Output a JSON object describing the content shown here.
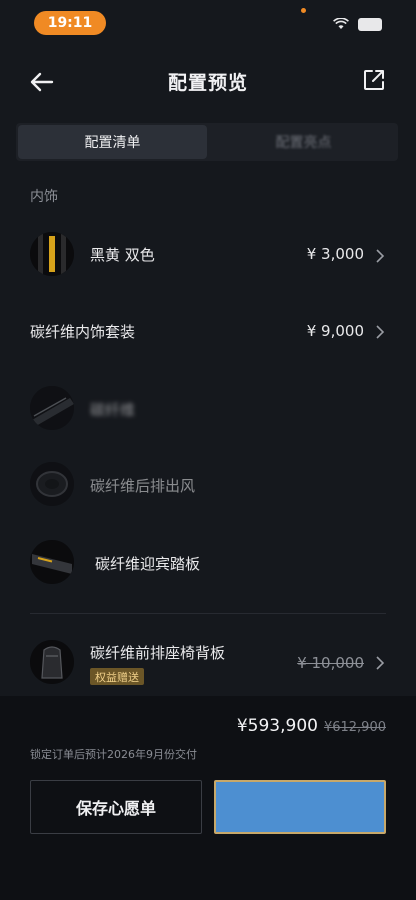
{
  "status": {
    "time": "19:11"
  },
  "header": {
    "title": "配置预览"
  },
  "tabs": [
    {
      "label": "配置清单"
    },
    {
      "label": "配置亮点"
    }
  ],
  "section": {
    "label": "内饰"
  },
  "items": [
    {
      "name": "黑黄 双色",
      "price": "¥ 3,000"
    },
    {
      "name": "碳纤维内饰套装",
      "price": "¥ 9,000"
    },
    {
      "name": "碳纤维"
    },
    {
      "name": "碳纤维后排出风"
    },
    {
      "name": "碳纤维迎宾踏板"
    },
    {
      "name": "碳纤维前排座椅背板",
      "badge": "权益赠送",
      "price": "¥ 10,000"
    }
  ],
  "footer": {
    "total": "¥593,900",
    "original_total": "¥612,900",
    "delivery_note": "锁定订单后预计2026年9月份交付",
    "wishlist_label": "保存心愿单"
  },
  "colors": {
    "accent": "#f08a24",
    "primary_button": "#4d8fd1",
    "badge_bg": "#6b5627"
  }
}
